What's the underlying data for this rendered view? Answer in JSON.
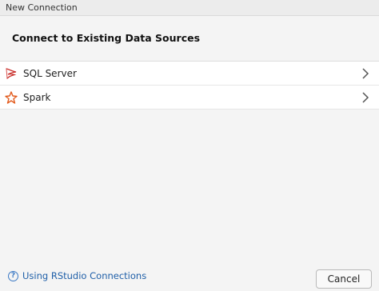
{
  "window": {
    "title": "New Connection"
  },
  "header": {
    "title": "Connect to Existing Data Sources"
  },
  "sources": [
    {
      "label": "SQL Server",
      "icon": "sql-server-icon"
    },
    {
      "label": "Spark",
      "icon": "spark-icon"
    }
  ],
  "footer": {
    "help_link": "Using RStudio Connections",
    "cancel_label": "Cancel"
  },
  "colors": {
    "link": "#1f5fa8",
    "spark_orange": "#e25a1c",
    "sql_red": "#c9302c"
  }
}
